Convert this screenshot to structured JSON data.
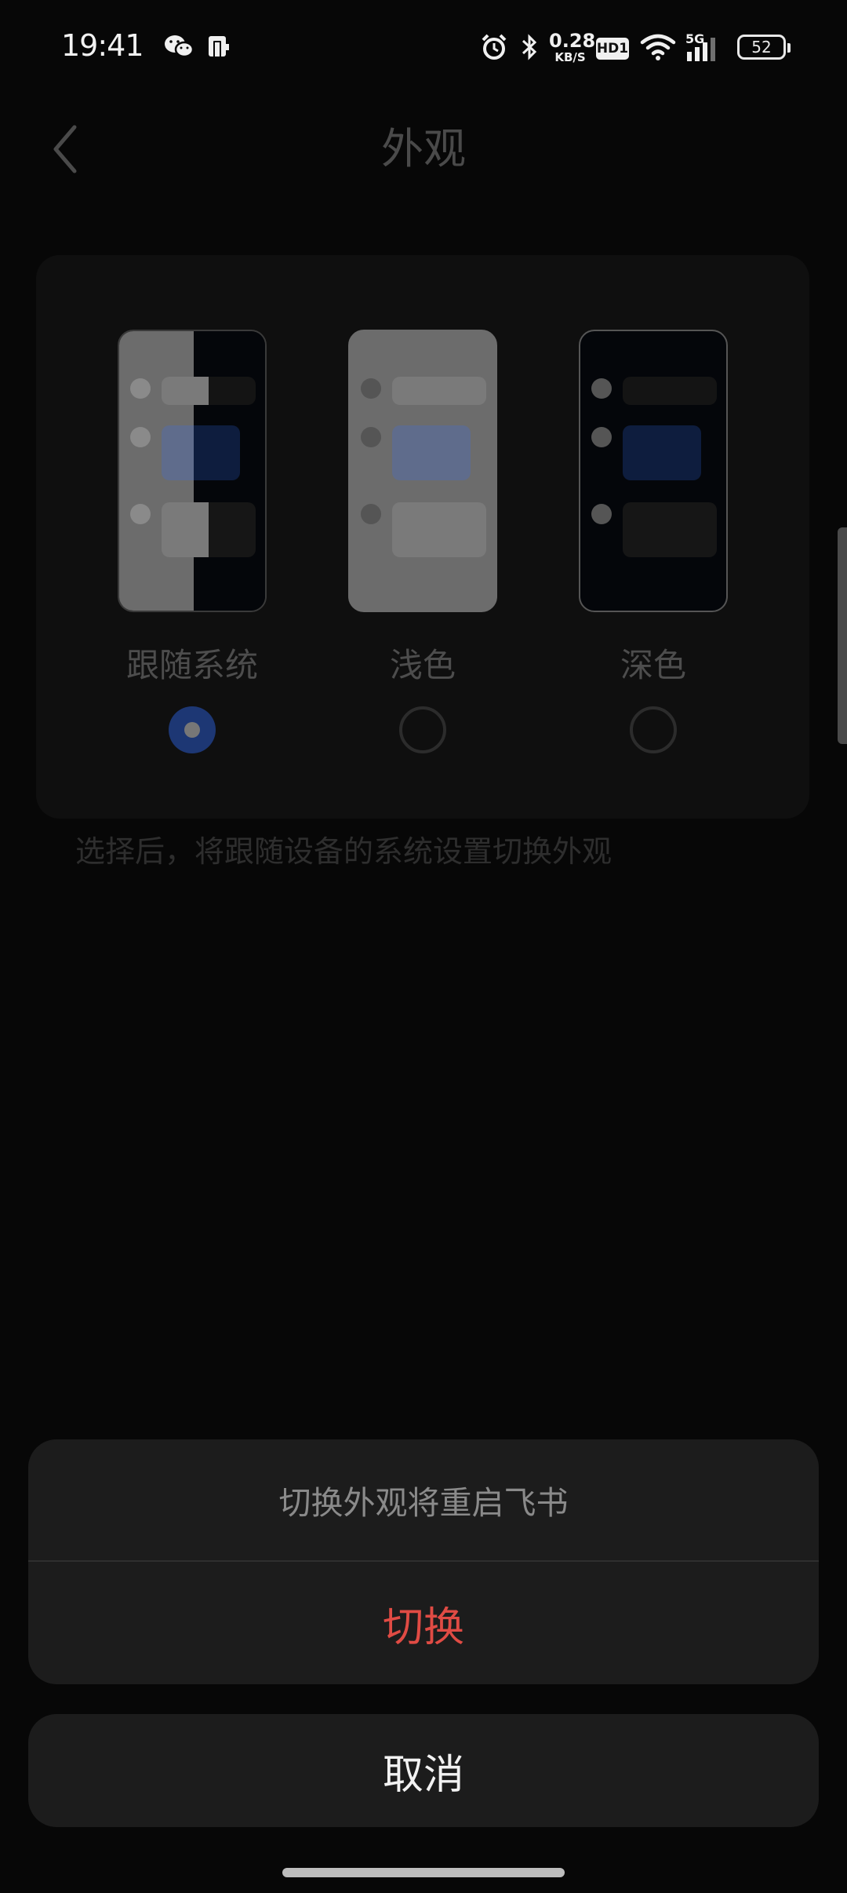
{
  "status_bar": {
    "time": "19:41",
    "icons": [
      "wechat-icon",
      "phone-clone-icon",
      "alarm-icon",
      "bluetooth-icon",
      "wifi-icon",
      "signal-icon"
    ],
    "net_speed_value": "0.28",
    "net_speed_unit": "KB/S",
    "hd_label": "HD1",
    "network_label": "5G",
    "battery_level": "52"
  },
  "header": {
    "title": "外观"
  },
  "appearance": {
    "options": [
      {
        "label": "跟随系统",
        "selected": true
      },
      {
        "label": "浅色",
        "selected": false
      },
      {
        "label": "深色",
        "selected": false
      }
    ],
    "hint": "选择后，将跟随设备的系统设置切换外观"
  },
  "action_sheet": {
    "message": "切换外观将重启飞书",
    "confirm_label": "切换",
    "cancel_label": "取消"
  },
  "colors": {
    "accent": "#1d3774",
    "destructive": "#e04b44",
    "sheet_bg": "#1c1c1c"
  }
}
